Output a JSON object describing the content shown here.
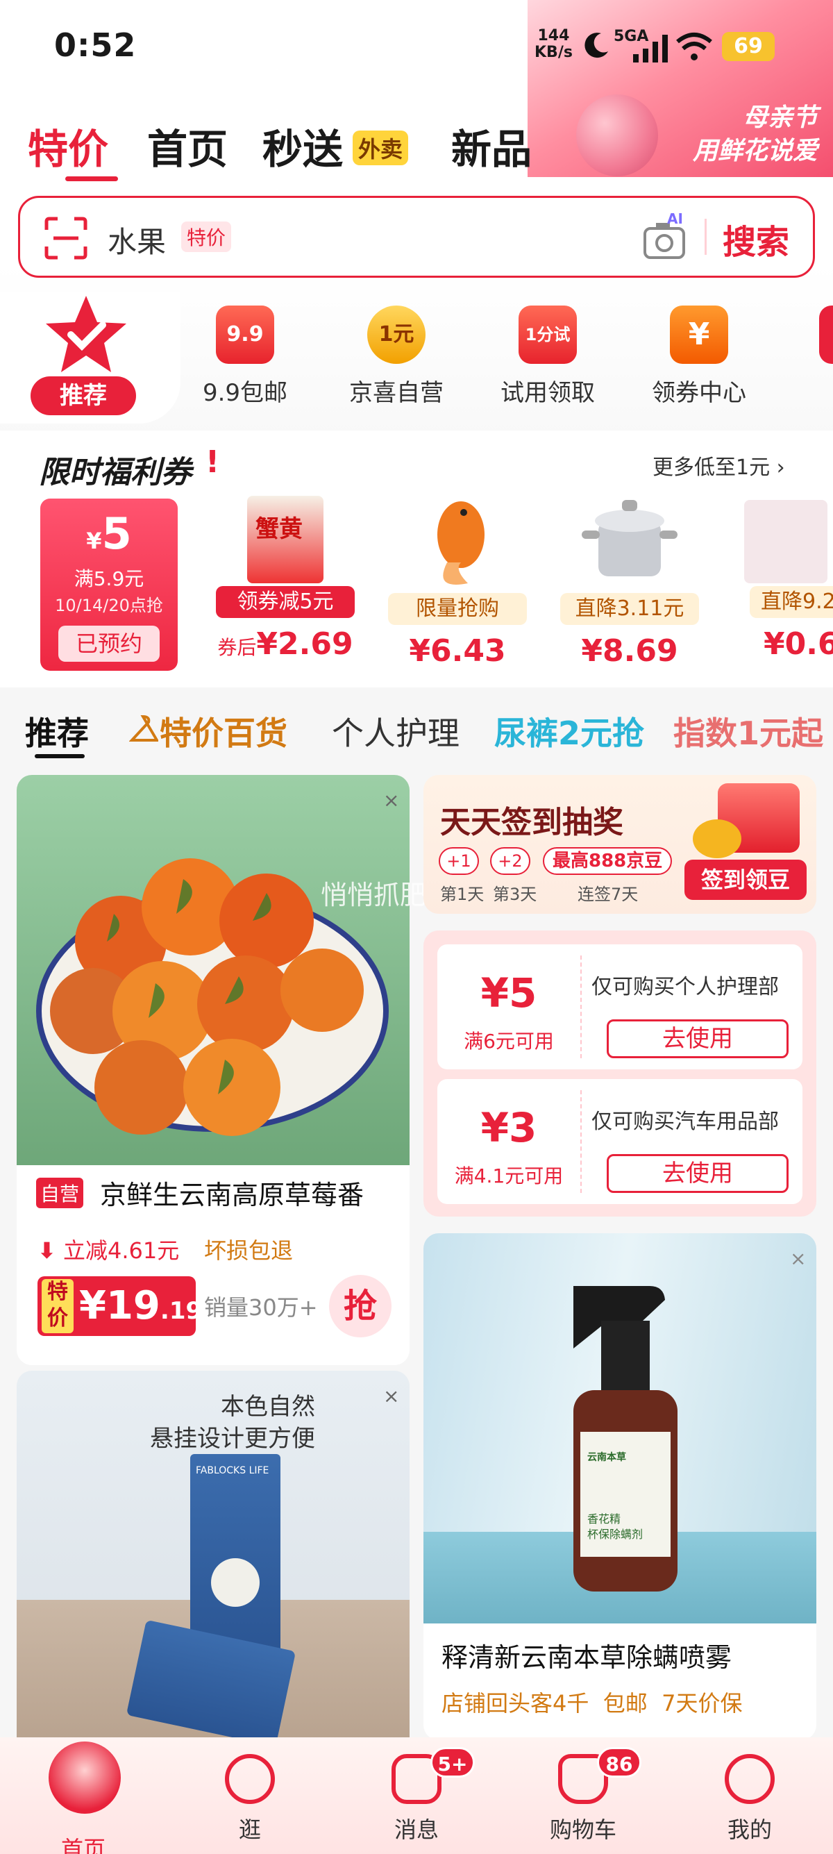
{
  "status": {
    "time": "0:52",
    "net_speed": "144",
    "net_unit": "KB/s",
    "signal": "5GA",
    "battery": "69"
  },
  "banner": {
    "line1": "母亲节",
    "line2": "用鲜花说爱"
  },
  "nav": {
    "tabs": [
      "特价",
      "首页",
      "秒送",
      "新品"
    ],
    "badge": "外卖"
  },
  "search": {
    "value": "水果",
    "tag": "特价",
    "ai": "AI",
    "button": "搜索"
  },
  "categories": {
    "recommend": "推荐",
    "items": [
      {
        "icon_text": "9.9",
        "label": "9.9包邮"
      },
      {
        "icon_text": "1元",
        "label": "京喜自营"
      },
      {
        "icon_text": "1分试",
        "label": "试用领取"
      },
      {
        "icon_text": "¥",
        "label": "领券中心"
      }
    ]
  },
  "welfare": {
    "title": "限时福利券",
    "more": "更多低至1元",
    "coupon": {
      "symbol": "¥",
      "amount": "5",
      "cond": "满5.9元",
      "time": "10/14/20点抢",
      "button": "已预约"
    },
    "products": [
      {
        "tag": "领券减5元",
        "price_prefix": "券后",
        "price": "¥2.69",
        "name": "蟹黄"
      },
      {
        "tag": "限量抢购",
        "price_prefix": "",
        "price": "¥6.43"
      },
      {
        "tag": "直降3.11元",
        "price_prefix": "",
        "price": "¥8.69"
      },
      {
        "tag": "直降9.2",
        "price_prefix": "",
        "price": "¥0.6"
      }
    ]
  },
  "tabs": {
    "items": [
      "推荐",
      "特价百货",
      "个人护理",
      "尿裤2元抢",
      "指数1元起"
    ]
  },
  "feed": {
    "product1": {
      "tag": "自营",
      "title": "京鲜生云南高原草莓番",
      "discount": "立减4.61元",
      "guarantee": "坏损包退",
      "price_tag_1": "特",
      "price_tag_2": "价",
      "price_int": "¥19",
      "price_dec": ".19",
      "sales": "销量30万+",
      "grab": "抢"
    },
    "watermark": "悄悄抓肥",
    "signin": {
      "title": "天天签到抽奖",
      "chips": [
        "+1",
        "+2"
      ],
      "max": "最高888京豆",
      "days": [
        "第1天",
        "第3天",
        "连签7天"
      ],
      "button": "签到领豆"
    },
    "coupons": [
      {
        "amount": "¥5",
        "cond": "满6元可用",
        "desc": "仅可购买个人护理部",
        "button": "去使用"
      },
      {
        "amount": "¥3",
        "cond": "满4.1元可用",
        "desc": "仅可购买汽车用品部",
        "button": "去使用"
      }
    ],
    "product2": {
      "title": "释清新云南本草除螨喷雾",
      "tags": [
        "店铺回头客4千",
        "包邮",
        "7天价保"
      ],
      "label1": "香花精",
      "label2": "杯保除螨剂",
      "brand": "云南本草"
    },
    "product3": {
      "line1": "本色自然",
      "line2": "悬挂设计更方便",
      "box": "FABLOCKS LIFE"
    }
  },
  "bottom_nav": {
    "items": [
      "首页",
      "逛",
      "消息",
      "购物车",
      "我的"
    ],
    "msg_badge": "5+",
    "cart_badge": "86"
  },
  "colors": {
    "accent": "#e8213a",
    "sky": "#2ab5d8",
    "gold": "#b25400"
  }
}
